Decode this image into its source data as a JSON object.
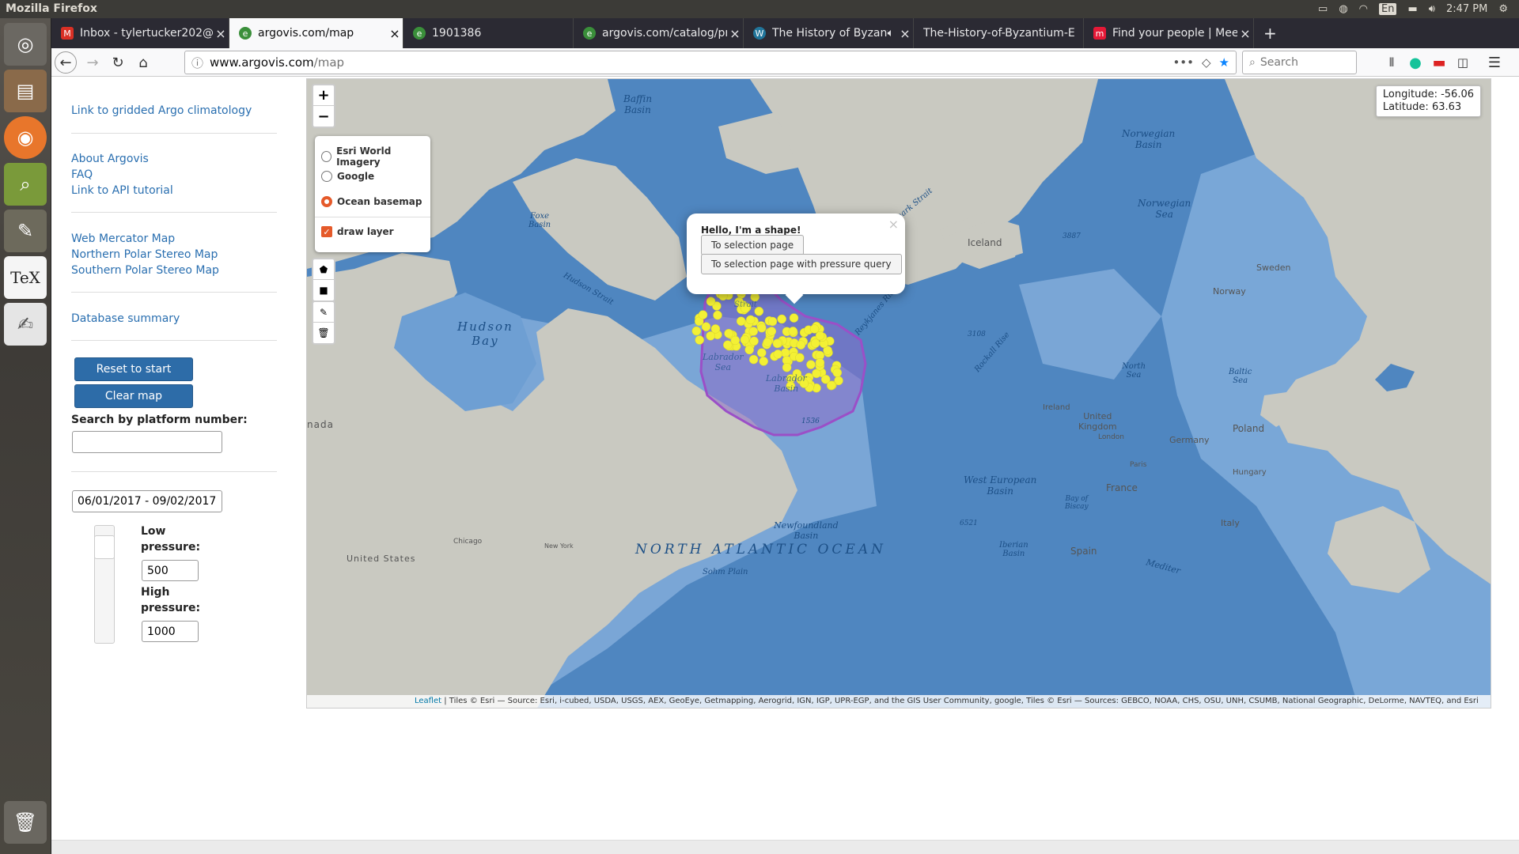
{
  "os": {
    "title": "Mozilla Firefox",
    "lang": "En",
    "time": "2:47 PM",
    "launcher": [
      "ubuntu-icon",
      "files-icon",
      "firefox-icon",
      "viewer-icon",
      "gimp-icon",
      "tex-icon",
      "text-editor-icon",
      "trash-icon"
    ]
  },
  "browser": {
    "tabs": [
      {
        "label": "Inbox - tylertucker202@",
        "icon": "gmail-icon",
        "color": "#d93025",
        "active": false
      },
      {
        "label": "argovis.com/map",
        "icon": "argovis-icon",
        "color": "#3a8f3a",
        "active": true
      },
      {
        "label": "1901386",
        "icon": "argovis-icon",
        "color": "#3a8f3a",
        "active": false
      },
      {
        "label": "argovis.com/catalog/pr",
        "icon": "argovis-icon",
        "color": "#3a8f3a",
        "active": false
      },
      {
        "label": "The History of Byzant",
        "icon": "wordpress-icon",
        "color": "#21759b",
        "active": false
      },
      {
        "label": "The-History-of-Byzantium-E",
        "icon": "",
        "color": "",
        "active": false
      },
      {
        "label": "Find your people | Meet",
        "icon": "meetup-icon",
        "color": "#e51937",
        "active": false
      }
    ],
    "url_base": "www.argovis.com",
    "url_path": "/map",
    "search_placeholder": "Search"
  },
  "sidebar": {
    "links_group1": [
      "Link to gridded Argo climatology"
    ],
    "links_group2": [
      "About Argovis",
      "FAQ",
      "Link to API tutorial"
    ],
    "links_group3": [
      "Web Mercator Map",
      "Northern Polar Stereo Map",
      "Southern Polar Stereo Map"
    ],
    "links_group4": [
      "Database summary"
    ],
    "reset_label": "Reset to start",
    "clear_label": "Clear map",
    "platform_label": "Search by platform number:",
    "platform_value": "",
    "date_range": "06/01/2017 - 09/02/2017",
    "low_label": "Low pressure:",
    "low_value": "500",
    "high_label": "High pressure:",
    "high_value": "1000"
  },
  "map": {
    "zoom_in": "+",
    "zoom_out": "−",
    "layers": [
      {
        "label": "Esri World Imagery",
        "type": "radio",
        "checked": false
      },
      {
        "label": "Google",
        "type": "radio",
        "checked": false
      },
      {
        "label": "Ocean basemap",
        "type": "radio",
        "checked": true
      },
      {
        "label": "draw layer",
        "type": "checkbox",
        "checked": true
      }
    ],
    "coord_lon": "Longitude: -56.06",
    "coord_lat": "Latitude: 63.63",
    "popup": {
      "title": "Hello, I'm a shape!",
      "btn1": "To selection page",
      "btn2": "To selection page with pressure query",
      "close": "×"
    },
    "labels": {
      "baffin": "Baffin\nBasin",
      "foxe": "Foxe\nBasin",
      "hudson_strait": "Hudson Strait",
      "hudson_bay": "Hudson\nBay",
      "nada": "nada",
      "labrador_sea": "Labrador\nSea",
      "labrador_basin": "Labrador\nBasin",
      "davis": "Strait",
      "denmark": "Denmark Strait",
      "iceland": "Iceland",
      "d3887": "3887",
      "norwegian_basin": "Norwegian\nBasin",
      "norwegian_sea": "Norwegian\nSea",
      "sweden": "Sweden",
      "norway": "Norway",
      "reykjanes": "Reykjanes Ridge",
      "d3108": "3108",
      "rockall": "Rockall Rise",
      "north_sea": "North\nSea",
      "baltic": "Baltic\nSea",
      "ireland": "Ireland",
      "uk": "United\nKingdom",
      "london": "London",
      "poland": "Poland",
      "germany": "Germany",
      "paris": "Paris",
      "france": "France",
      "hungary": "Hungary",
      "d1536": "1536",
      "west_european": "West European\nBasin",
      "biscay": "Bay of\nBiscay",
      "newfoundland": "Newfoundland\nBasin",
      "d6521": "6521",
      "italy": "Italy",
      "iberian": "Iberian\nBasin",
      "spain": "Spain",
      "chicago": "Chicago",
      "new_york": "New York",
      "united_states": "United States",
      "north_atlantic": "NORTH ATLANTIC OCEAN",
      "sohm": "Sohm Plain",
      "mediter": "Mediter"
    },
    "attribution_link": "Leaflet",
    "attribution": " | Tiles © Esri — Source: Esri, i-cubed, USDA, USGS, AEX, GeoEye, Getmapping, Aerogrid, IGN, IGP, UPR-EGP, and the GIS User Community, google, Tiles © Esri — Sources: GEBCO, NOAA, CHS, OSU, UNH, CSUMB, National Geographic, DeLorme, NAVTEQ, and Esri",
    "colors": {
      "ocean": "#4f86c0",
      "land": "#c9c9c1",
      "shape_fill": "#8a6cc9",
      "shape_stroke": "#9b4fc7",
      "float": "#f3f035"
    }
  }
}
